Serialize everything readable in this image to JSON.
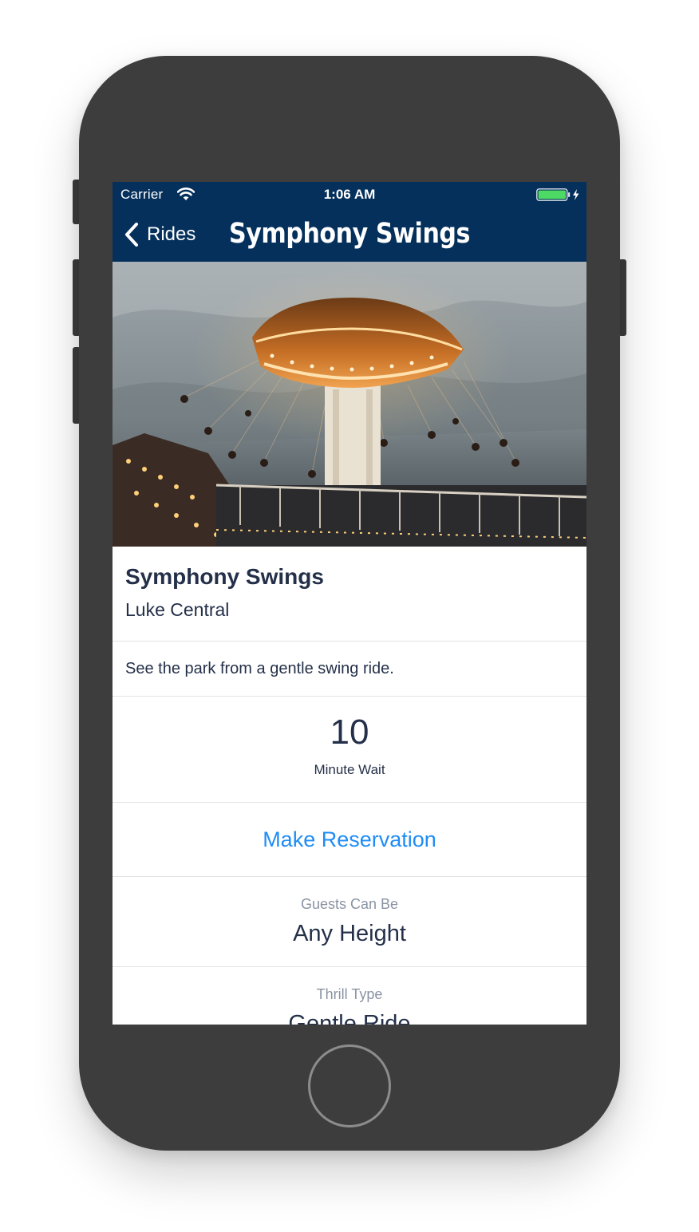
{
  "status_bar": {
    "carrier": "Carrier",
    "time": "1:06 AM",
    "wifi_icon": "wifi-icon",
    "battery_icon": "battery-charging-icon",
    "battery_color": "#4cd964"
  },
  "nav": {
    "back_label": "Rides",
    "back_icon": "chevron-left-icon",
    "title": "Symphony Swings",
    "background": "#05305c"
  },
  "hero": {
    "image": "swing-ride-photo"
  },
  "ride": {
    "name": "Symphony Swings",
    "area": "Luke Central",
    "description": "See the park from a gentle swing ride."
  },
  "wait": {
    "value": "10",
    "label": "Minute Wait"
  },
  "reservation": {
    "label": "Make Reservation",
    "color": "#1f8cf6"
  },
  "details": [
    {
      "label": "Guests Can Be",
      "value": "Any Height"
    },
    {
      "label": "Thrill Type",
      "value": "Gentle Ride"
    }
  ]
}
